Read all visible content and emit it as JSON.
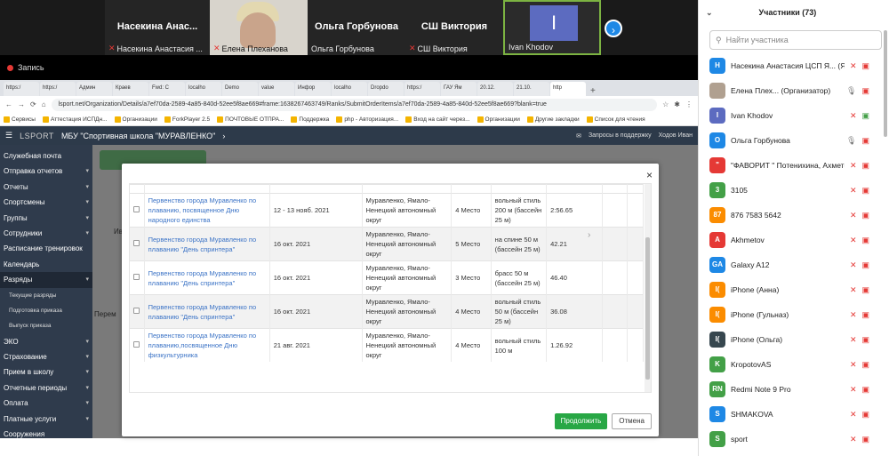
{
  "video": {
    "tiles": [
      {
        "big": "Насекина Анас...",
        "caption": "Насекина Анастасия ..."
      },
      {
        "big": "",
        "caption": "Елена Плеханова"
      },
      {
        "big": "Ольга Горбунова",
        "caption": "Ольга Горбунова"
      },
      {
        "big": "СШ Виктория",
        "caption": "СШ Виктория"
      },
      {
        "big": "I",
        "caption": "Ivan Khodov"
      }
    ],
    "next": "›",
    "recording": "Запись"
  },
  "browser": {
    "tabs": [
      "https:/",
      "https:/",
      "Админ",
      "Краев",
      "Fwd: C",
      "localho",
      "Demo",
      "value",
      "Инфор",
      "localho",
      "Dropdo",
      "https:/",
      "ГАУ Ям",
      "20.12.",
      "21.10.",
      "http"
    ],
    "url": "lsport.net/Organization/Details/a7ef70da-2589-4a85-840d-52ee5f8ae669#frame:1638267463749/Ranks/SubmitOrderItems/a7ef70da-2589-4a85-840d-52ee5f8ae669?blank=true",
    "bookmarks": [
      "Сервисы",
      "Аттестация ИСПДн...",
      "Организации",
      "ForkPlayer 2.5",
      "ПОЧТОВЫЕ ОТПРА...",
      "Поддержка",
      "php - Авторизация...",
      "Вход на сайт через...",
      "Организации",
      "Другие закладки",
      "Список для чтения"
    ]
  },
  "app": {
    "logo": "LSPORT",
    "org": "МБУ \"Спортивная школа \"МУРАВЛЕНКО\"",
    "support": "Запросы в поддержку",
    "user": "Ходов Иван",
    "sidebar": [
      {
        "label": "Служебная почта",
        "arrow": false
      },
      {
        "label": "Отправка отчетов",
        "arrow": true
      },
      {
        "label": "Отчеты",
        "arrow": true
      },
      {
        "label": "Спортсмены",
        "arrow": true
      },
      {
        "label": "Группы",
        "arrow": true
      },
      {
        "label": "Сотрудники",
        "arrow": true
      },
      {
        "label": "Расписание тренировок",
        "arrow": false
      },
      {
        "label": "Календарь",
        "arrow": false
      },
      {
        "label": "Разряды",
        "arrow": true,
        "active": true
      },
      {
        "label": "Текущие разряды",
        "sub": true
      },
      {
        "label": "Подготовка приказа",
        "sub": true
      },
      {
        "label": "Выпуск приказа",
        "sub": true
      },
      {
        "label": "ЭКО",
        "arrow": true
      },
      {
        "label": "Страхование",
        "arrow": true
      },
      {
        "label": "Прием в школу",
        "arrow": true
      },
      {
        "label": "Отчетные периоды",
        "arrow": true
      },
      {
        "label": "Оплата",
        "arrow": true
      },
      {
        "label": "Платные услуги",
        "arrow": true
      },
      {
        "label": "Сооружения",
        "arrow": false
      },
      {
        "label": "Иерархия",
        "arrow": false
      }
    ],
    "under": {
      "label_1": "Перем",
      "label_2": "Ив"
    }
  },
  "modal": {
    "close": "×",
    "rows": [
      {
        "event": "Первенство города Муравленко по плаванию, посвященное Дню народного единства",
        "date": "12 - 13 нояб. 2021",
        "place": "Муравленко, Ямало-Ненецкий автономный округ",
        "rank": "4 Место",
        "discipline": "вольный стиль 200 м (бассейн 25 м)",
        "result": "2:56.65"
      },
      {
        "event": "Первенство города Муравленко по плаванию \"День спринтера\"",
        "date": "16 окт. 2021",
        "place": "Муравленко, Ямало-Ненецкий автономный округ",
        "rank": "5 Место",
        "discipline": "на спине 50 м (бассейн 25 м)",
        "result": "42.21"
      },
      {
        "event": "Первенство города Муравленко по плаванию \"День спринтера\"",
        "date": "16 окт. 2021",
        "place": "Муравленко, Ямало-Ненецкий автономный округ",
        "rank": "3 Место",
        "discipline": "брасс 50 м (бассейн 25 м)",
        "result": "46.40"
      },
      {
        "event": "Первенство города Муравленко по плаванию \"День спринтера\"",
        "date": "16 окт. 2021",
        "place": "Муравленко, Ямало-Ненецкий автономный округ",
        "rank": "4 Место",
        "discipline": "вольный стиль 50 м (бассейн 25 м)",
        "result": "36.08"
      },
      {
        "event": "Первенство города Муравленко по плаванию,посвященное Дню физкультурника",
        "date": "21 авг. 2021",
        "place": "Муравленко, Ямало-Ненецкий автономный округ",
        "rank": "4 Место",
        "discipline": "вольный стиль 100 м",
        "result": "1.26.92"
      }
    ],
    "ok": "Продолжить",
    "cancel": "Отмена"
  },
  "participants": {
    "title": "Участники (73)",
    "search_placeholder": "Найти участника",
    "list": [
      {
        "initials": "Н",
        "color": "#1e88e5",
        "name": "Насекина Анастасия ЦСП Я... (Я)"
      },
      {
        "initials": "",
        "color": "#b0a090",
        "name": "Елена Плех... (Организатор)"
      },
      {
        "initials": "I",
        "color": "#5c6bc0",
        "name": "Ivan Khodov"
      },
      {
        "initials": "О",
        "color": "#1e88e5",
        "name": "Ольга Горбунова"
      },
      {
        "initials": "\"",
        "color": "#e53935",
        "name": "\"ФАВОРИТ \" Потенихина, Ахметов, ..."
      },
      {
        "initials": "3",
        "color": "#43a047",
        "name": "3105"
      },
      {
        "initials": "87",
        "color": "#fb8c00",
        "name": "876 7583 5642"
      },
      {
        "initials": "A",
        "color": "#e53935",
        "name": "Akhmetov"
      },
      {
        "initials": "GA",
        "color": "#1e88e5",
        "name": "Galaxy A12"
      },
      {
        "initials": "I(",
        "color": "#fb8c00",
        "name": "iPhone (Анна)"
      },
      {
        "initials": "I(",
        "color": "#fb8c00",
        "name": "iPhone (Гульназ)"
      },
      {
        "initials": "I(",
        "color": "#37474f",
        "name": "iPhone (Ольга)"
      },
      {
        "initials": "K",
        "color": "#43a047",
        "name": "KropotovAS"
      },
      {
        "initials": "RN",
        "color": "#43a047",
        "name": "Redmi Note 9 Pro"
      },
      {
        "initials": "S",
        "color": "#1e88e5",
        "name": "SHMAKOVA"
      },
      {
        "initials": "S",
        "color": "#43a047",
        "name": "sport"
      }
    ]
  }
}
